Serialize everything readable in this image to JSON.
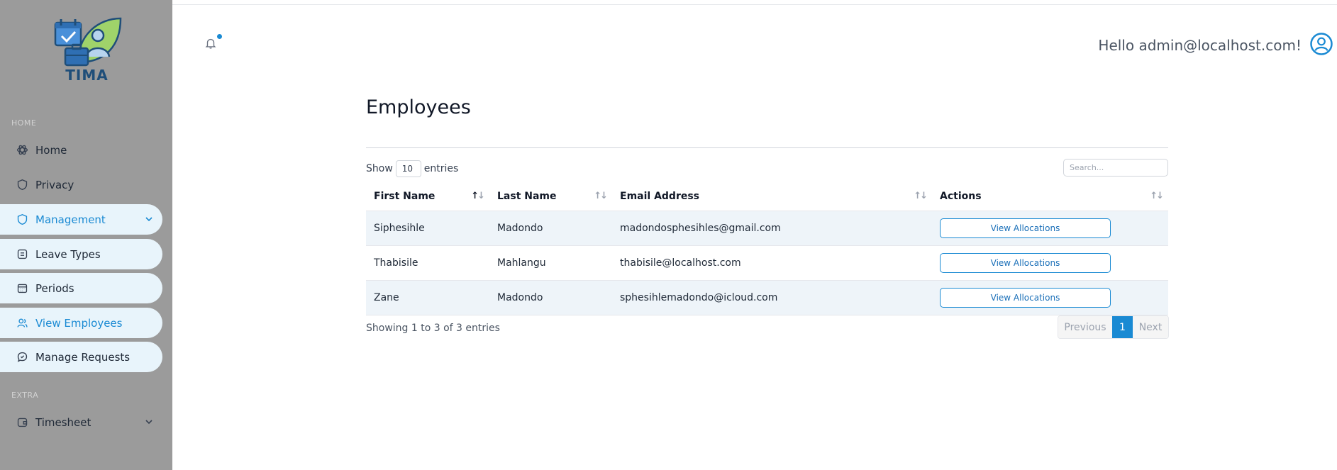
{
  "app": {
    "name": "TIMA"
  },
  "sidebar": {
    "home_section": "HOME",
    "extra_section": "EXTRA",
    "items": [
      {
        "label": "Home",
        "icon": "atom-icon"
      },
      {
        "label": "Privacy",
        "icon": "shield-icon"
      },
      {
        "label": "Management",
        "icon": "shield-icon",
        "active": true,
        "expanded": true
      },
      {
        "label": "Leave Types",
        "icon": "list-icon"
      },
      {
        "label": "Periods",
        "icon": "calendar-icon"
      },
      {
        "label": "View Employees",
        "icon": "users-icon",
        "active": true
      },
      {
        "label": "Manage Requests",
        "icon": "chat-icon"
      },
      {
        "label": "Timesheet",
        "icon": "wallet-icon"
      }
    ]
  },
  "header": {
    "greeting": "Hello admin@localhost.com!"
  },
  "main": {
    "title": "Employees",
    "show_label": "Show",
    "entries_label": "entries",
    "page_size": "10",
    "search_placeholder": "Search...",
    "table": {
      "columns": [
        "First Name",
        "Last Name",
        "Email Address",
        "Actions"
      ],
      "rows": [
        {
          "first": "Siphesihle",
          "last": "Madondo",
          "email": "madondosphesihles@gmail.com",
          "action": "View Allocations"
        },
        {
          "first": "Thabisile",
          "last": "Mahlangu",
          "email": "thabisile@localhost.com",
          "action": "View Allocations"
        },
        {
          "first": "Zane",
          "last": "Madondo",
          "email": "sphesihlemadondo@icloud.com",
          "action": "View Allocations"
        }
      ]
    },
    "info": "Showing 1 to 3 of 3 entries",
    "pagination": {
      "previous": "Previous",
      "current": "1",
      "next": "Next"
    }
  },
  "colors": {
    "accent": "#1a8ad3",
    "sidebar_bg": "#9b9b9b",
    "pill_bg": "#e8f4fb"
  }
}
